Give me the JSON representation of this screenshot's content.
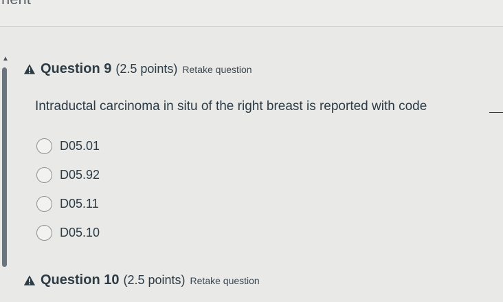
{
  "top": {
    "partial_text": "nent"
  },
  "question9": {
    "title": "Question 9",
    "points": "(2.5 points)",
    "retake": "Retake question",
    "stem": "Intraductal carcinoma in situ of the right breast is reported with code",
    "options": [
      "D05.01",
      "D05.92",
      "D05.11",
      "D05.10"
    ]
  },
  "question10": {
    "title": "Question 10",
    "points": "(2.5 points)",
    "retake": "Retake question"
  },
  "colors": {
    "background": "#e9e9e7",
    "text": "#2d3b45",
    "warning_icon": "#2d3b45",
    "left_bar": "#6b7580"
  }
}
